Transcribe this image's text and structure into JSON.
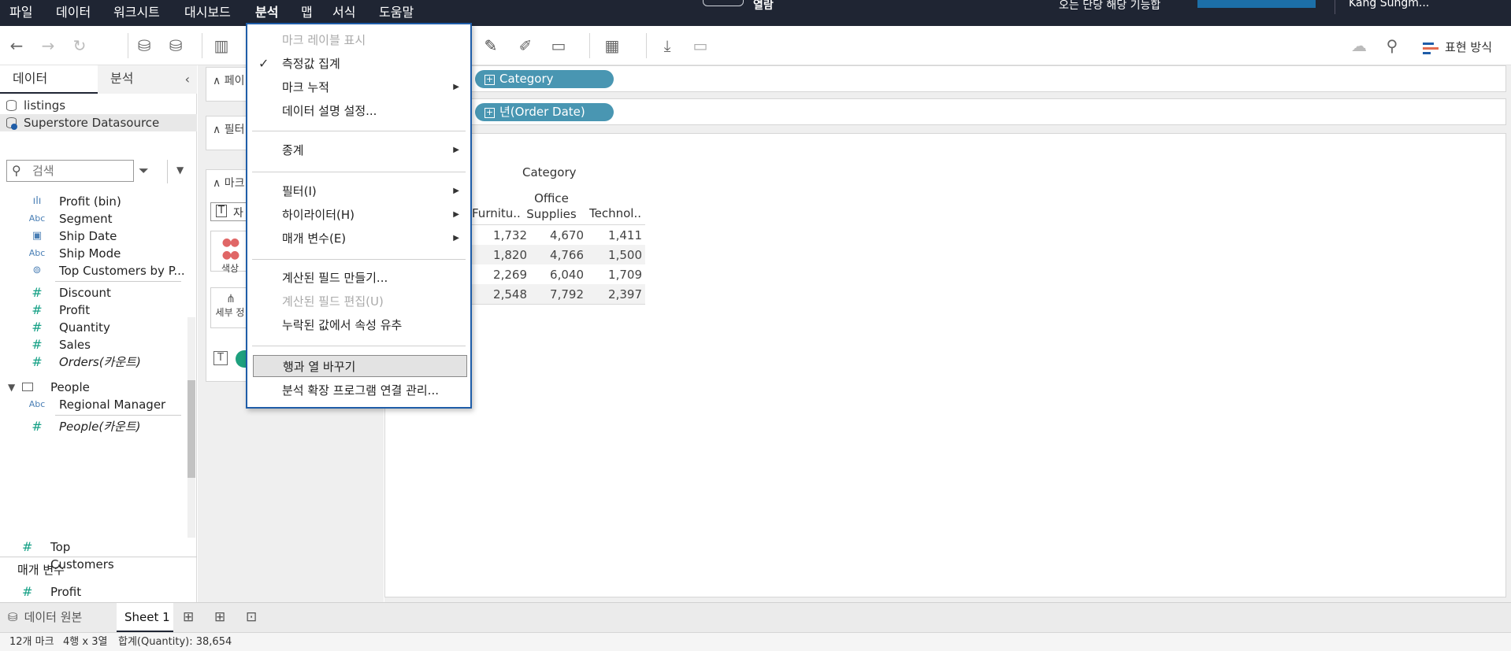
{
  "menubar": {
    "items": [
      "파일",
      "데이터",
      "워크시트",
      "대시보드",
      "분석",
      "맵",
      "서식",
      "도움말"
    ],
    "active_index": 4,
    "title": "열람",
    "subtitle": "오는 단당 해당 기능합",
    "user": "Kang Sungm..."
  },
  "toolbar": {
    "show_me": "표현 방식"
  },
  "leftpane": {
    "tabs": [
      "데이터",
      "분석"
    ],
    "datasources": [
      "listings",
      "Superstore Datasource"
    ],
    "search": {
      "placeholder": "검색"
    },
    "dimensions": [
      {
        "icon": "bin-icon",
        "name": "Profit (bin)"
      },
      {
        "icon": "abc-icon",
        "name": "Segment"
      },
      {
        "icon": "calendar-icon",
        "name": "Ship Date"
      },
      {
        "icon": "abc-icon",
        "name": "Ship Mode"
      },
      {
        "icon": "set-icon",
        "name": "Top Customers by P..."
      }
    ],
    "measures": [
      "Discount",
      "Profit",
      "Quantity",
      "Sales",
      "Orders(카운트)"
    ],
    "folder": "People",
    "folder_dims": [
      "Regional Manager"
    ],
    "folder_measures": [
      "People(카운트)"
    ],
    "params_header": "매개 변수",
    "params": [
      "Profit Bin Size",
      "Top Customers"
    ]
  },
  "cards": {
    "pages": "페이",
    "filters": "필터",
    "marks": "마크",
    "marks_type": "자",
    "color_label": "색상",
    "detail_label": "세부 정"
  },
  "shelves": {
    "columns_pill": "Category",
    "rows_pill": "년(Order Date)"
  },
  "crosstab": {
    "header": "Category",
    "columns": [
      "Furnitu..",
      "Office Supplies",
      "Technol.."
    ],
    "rows": [
      [
        "1,732",
        "4,670",
        "1,411"
      ],
      [
        "1,820",
        "4,766",
        "1,500"
      ],
      [
        "2,269",
        "6,040",
        "1,709"
      ],
      [
        "2,548",
        "7,792",
        "2,397"
      ]
    ]
  },
  "dropdown": {
    "items": [
      {
        "label": "마크 레이블 표시",
        "disabled": true,
        "checked": false,
        "submenu": false
      },
      {
        "label": "측정값 집계",
        "disabled": false,
        "checked": true,
        "submenu": false
      },
      {
        "label": "마크 누적",
        "disabled": false,
        "checked": false,
        "submenu": true
      },
      {
        "label": "데이터 설명 설정...",
        "disabled": false,
        "checked": false,
        "submenu": false
      },
      {
        "label": "종계",
        "disabled": false,
        "checked": false,
        "submenu": true
      },
      {
        "label": "필터(I)",
        "disabled": false,
        "checked": false,
        "submenu": true
      },
      {
        "label": "하이라이터(H)",
        "disabled": false,
        "checked": false,
        "submenu": true
      },
      {
        "label": "매개 변수(E)",
        "disabled": false,
        "checked": false,
        "submenu": true
      },
      {
        "label": "계산된 필드 만들기...",
        "disabled": false,
        "checked": false,
        "submenu": false
      },
      {
        "label": "계산된 필드 편집(U)",
        "disabled": true,
        "checked": false,
        "submenu": false
      },
      {
        "label": "누락된 값에서 속성 유추",
        "disabled": false,
        "checked": false,
        "submenu": false
      },
      {
        "label": "행과 열 바꾸기",
        "disabled": false,
        "checked": false,
        "submenu": false
      },
      {
        "label": "분석 확장 프로그램 연결 관리...",
        "disabled": false,
        "checked": false,
        "submenu": false
      }
    ],
    "highlighted_index": 11
  },
  "sheettabs": {
    "source": "데이터 원본",
    "active": "Sheet 1"
  },
  "status": {
    "marks": "12개 마크",
    "dims": "4행 x 3열",
    "sum": "합계(Quantity): 38,654"
  },
  "colors": {
    "menubar_bg": "#1f2533",
    "pill_blue": "#4996b2",
    "measure_green": "#14a085",
    "menu_border": "#1f5da8"
  }
}
